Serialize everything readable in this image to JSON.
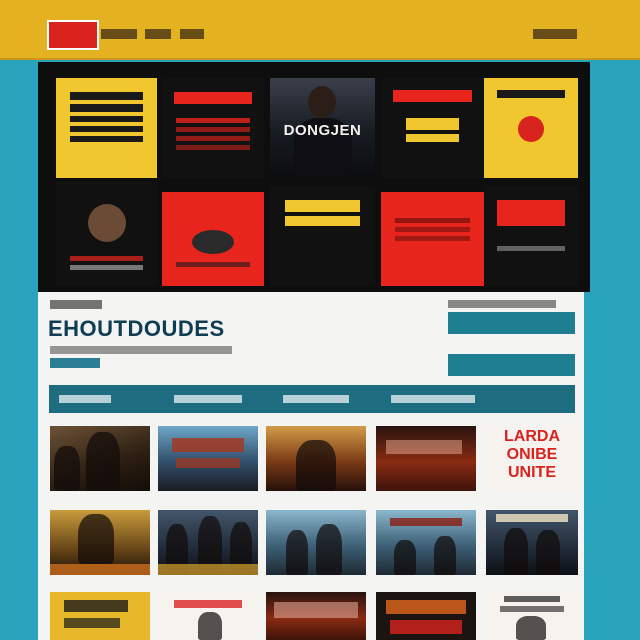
{
  "header": {
    "logo_text": "",
    "nav": [
      "",
      "",
      ""
    ],
    "right_link": ""
  },
  "hero": {
    "tiles": [
      {
        "text": ""
      },
      {
        "text": ""
      },
      {
        "text": "DONGJEN"
      },
      {
        "text": ""
      },
      {
        "text": ""
      },
      {
        "text": ""
      },
      {
        "text": ""
      },
      {
        "text": ""
      },
      {
        "text": ""
      },
      {
        "text": ""
      }
    ]
  },
  "panel": {
    "kicker": "",
    "title": "EHOUTDOUDES",
    "subtitle": "",
    "tag": "",
    "side_label": ""
  },
  "tabs": [
    "",
    "",
    "",
    ""
  ],
  "posters": [
    {
      "text": ""
    },
    {
      "text": ""
    },
    {
      "text": ""
    },
    {
      "text": ""
    },
    {
      "text": "LARDA ONIBE UNITE"
    },
    {
      "text": ""
    },
    {
      "text": ""
    },
    {
      "text": ""
    },
    {
      "text": ""
    },
    {
      "text": ""
    },
    {
      "text": ""
    },
    {
      "text": ""
    },
    {
      "text": ""
    },
    {
      "text": ""
    },
    {
      "text": ""
    }
  ],
  "colors": {
    "page_bg": "#2aa3bd",
    "header": "#e4b221",
    "hero_bg": "#0e0e0e",
    "accent_red": "#e8251d",
    "accent_yellow": "#f1c730",
    "panel_bg": "#f4f4f2",
    "teal": "#1d6c80",
    "title": "#0f3d54"
  }
}
